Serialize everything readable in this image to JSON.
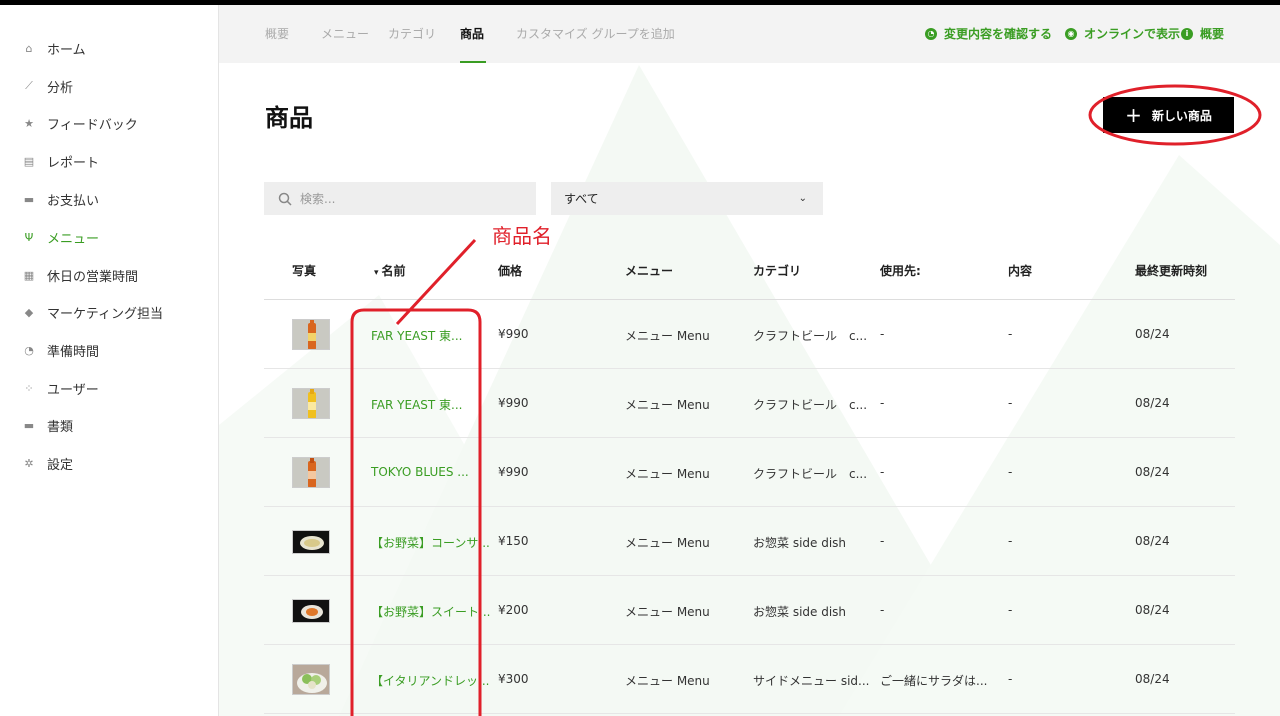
{
  "colors": {
    "accent": "#3a9d23",
    "annotation": "#e0202a",
    "button": "#000000"
  },
  "sidebar": {
    "items": [
      {
        "label": "ホーム",
        "icon": "home-icon",
        "glyph": "⌂"
      },
      {
        "label": "分析",
        "icon": "chart-icon",
        "glyph": "⟋"
      },
      {
        "label": "フィードバック",
        "icon": "star-icon",
        "glyph": "★"
      },
      {
        "label": "レポート",
        "icon": "report-icon",
        "glyph": "▤"
      },
      {
        "label": "お支払い",
        "icon": "payment-icon",
        "glyph": "▬"
      },
      {
        "label": "メニュー",
        "icon": "cutlery-icon",
        "glyph": "Ψ",
        "active": true
      },
      {
        "label": "休日の営業時間",
        "icon": "calendar-icon",
        "glyph": "▦"
      },
      {
        "label": "マーケティング担当",
        "icon": "tag-icon",
        "glyph": "◆"
      },
      {
        "label": "準備時間",
        "icon": "clock-icon",
        "glyph": "◔"
      },
      {
        "label": "ユーザー",
        "icon": "users-icon",
        "glyph": "⁘"
      },
      {
        "label": "書類",
        "icon": "folder-icon",
        "glyph": "▬"
      },
      {
        "label": "設定",
        "icon": "gear-icon",
        "glyph": "✲"
      }
    ]
  },
  "tabs": [
    {
      "label": "概要"
    },
    {
      "label": "メニュー"
    },
    {
      "label": "カテゴリ"
    },
    {
      "label": "商品",
      "active": true
    },
    {
      "label": "カスタマイズ グループを追加"
    }
  ],
  "header_links": {
    "review": "変更内容を確認する",
    "online": "オンラインで表示",
    "overview": "概要"
  },
  "page": {
    "title": "商品",
    "new_button": "新しい商品"
  },
  "search": {
    "placeholder": "検索..."
  },
  "filter": {
    "selected": "すべて"
  },
  "table": {
    "headers": {
      "photo": "写真",
      "name": "名前",
      "price": "価格",
      "menu": "メニュー",
      "category": "カテゴリ",
      "used_in": "使用先:",
      "content": "内容",
      "updated": "最終更新時刻"
    },
    "rows": [
      {
        "name": "FAR YEAST 東...",
        "price": "¥990",
        "menu": "メニュー Menu",
        "category": "クラフトビール　c...",
        "used_in": "-",
        "content": "-",
        "updated": "08/24",
        "thumb": "beer-orange"
      },
      {
        "name": "FAR YEAST 東...",
        "price": "¥990",
        "menu": "メニュー Menu",
        "category": "クラフトビール　c...",
        "used_in": "-",
        "content": "-",
        "updated": "08/24",
        "thumb": "beer-yellow"
      },
      {
        "name": "TOKYO BLUES ...",
        "price": "¥990",
        "menu": "メニュー Menu",
        "category": "クラフトビール　c...",
        "used_in": "-",
        "content": "-",
        "updated": "08/24",
        "thumb": "beer-orange"
      },
      {
        "name": "【お野菜】コーンサ...",
        "price": "¥150",
        "menu": "メニュー Menu",
        "category": "お惣菜 side dish",
        "used_in": "-",
        "content": "-",
        "updated": "08/24",
        "thumb": "dish-dark"
      },
      {
        "name": "【お野菜】スイート...",
        "price": "¥200",
        "menu": "メニュー Menu",
        "category": "お惣菜 side dish",
        "used_in": "-",
        "content": "-",
        "updated": "08/24",
        "thumb": "dish-orange"
      },
      {
        "name": "【イタリアンドレッ...",
        "price": "¥300",
        "menu": "メニュー Menu",
        "category": "サイドメニュー sid...",
        "used_in": "ご一緒にサラダは...",
        "content": "-",
        "updated": "08/24",
        "thumb": "salad"
      }
    ]
  },
  "annotation": {
    "label": "商品名"
  }
}
